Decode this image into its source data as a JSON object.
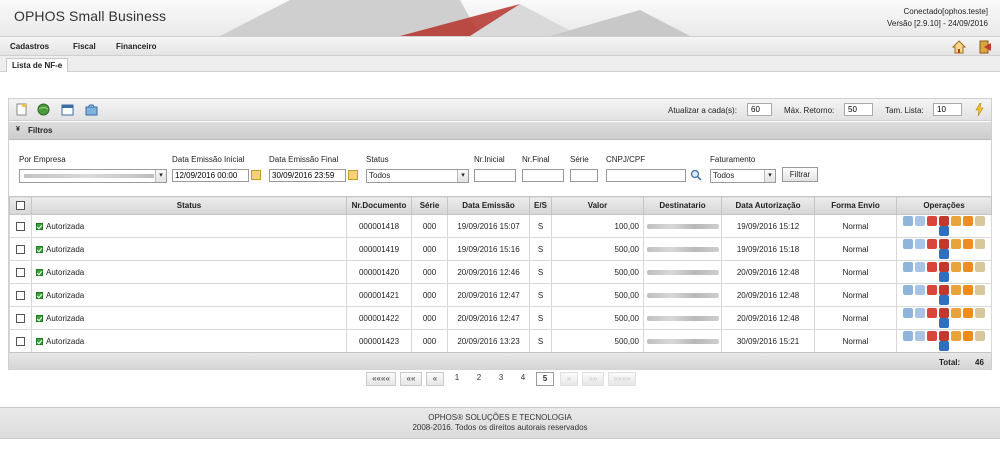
{
  "app": {
    "title": "OPHOS Small Business",
    "connected": "Conectado[ophos.teste]",
    "version": "Versão [2.9.10] - 24/09/2016"
  },
  "menu": {
    "items": [
      "Cadastros",
      "Fiscal",
      "Financeiro"
    ]
  },
  "header_icons": [
    "home-icon",
    "exit-icon"
  ],
  "tab": {
    "label": "Lista de NF-e"
  },
  "toolbar": {
    "icons": [
      "new-document-icon",
      "globe-icon",
      "calendar-icon",
      "refresh-folder-icon"
    ],
    "refresh_label": "Atualizar a cada(s):",
    "refresh_value": "60",
    "max_return_label": "Máx. Retorno:",
    "max_return_value": "50",
    "list_size_label": "Tam. Lista:",
    "list_size_value": "10",
    "flash_icon": "lightning-icon"
  },
  "filters": {
    "title": "Filtros",
    "empresa_label": "Por Empresa",
    "data_ini_label": "Data Emissão Inicial",
    "data_ini_value": "12/09/2016 00:00",
    "data_fim_label": "Data Emissão Final",
    "data_fim_value": "30/09/2016 23:59",
    "status_label": "Status",
    "status_value": "Todos",
    "nr_inicial_label": "Nr.Inicial",
    "nr_final_label": "Nr.Final",
    "serie_label": "Série",
    "cnpj_label": "CNPJ/CPF",
    "faturamento_label": "Faturamento",
    "faturamento_value": "Todos",
    "filter_button": "Filtrar"
  },
  "table": {
    "headers": [
      "Status",
      "Nr.Documento",
      "Série",
      "Data Emissão",
      "E/S",
      "Valor",
      "Destinatario",
      "Data Autorização",
      "Forma Envio",
      "Operações"
    ],
    "rows": [
      {
        "status": "Autorizada",
        "doc": "000001418",
        "serie": "000",
        "emissao": "19/09/2016 15:07",
        "es": "S",
        "valor": "100,00",
        "autorizacao": "19/09/2016 15:12",
        "envio": "Normal"
      },
      {
        "status": "Autorizada",
        "doc": "000001419",
        "serie": "000",
        "emissao": "19/09/2016 15:16",
        "es": "S",
        "valor": "500,00",
        "autorizacao": "19/09/2016 15:18",
        "envio": "Normal"
      },
      {
        "status": "Autorizada",
        "doc": "000001420",
        "serie": "000",
        "emissao": "20/09/2016 12:46",
        "es": "S",
        "valor": "500,00",
        "autorizacao": "20/09/2016 12:48",
        "envio": "Normal"
      },
      {
        "status": "Autorizada",
        "doc": "000001421",
        "serie": "000",
        "emissao": "20/09/2016 12:47",
        "es": "S",
        "valor": "500,00",
        "autorizacao": "20/09/2016 12:48",
        "envio": "Normal"
      },
      {
        "status": "Autorizada",
        "doc": "000001422",
        "serie": "000",
        "emissao": "20/09/2016 12:47",
        "es": "S",
        "valor": "500,00",
        "autorizacao": "20/09/2016 12:48",
        "envio": "Normal"
      },
      {
        "status": "Autorizada",
        "doc": "000001423",
        "serie": "000",
        "emissao": "20/09/2016 13:23",
        "es": "S",
        "valor": "500,00",
        "autorizacao": "30/09/2016 15:21",
        "envio": "Normal"
      }
    ],
    "operation_icons": [
      "magnify-icon",
      "copy-icon",
      "cancel-icon",
      "pdf-icon",
      "xml-icon",
      "rss-icon",
      "email-icon",
      "info-icon"
    ],
    "total_label": "Total:",
    "total_value": "46"
  },
  "pager": {
    "first": "««««",
    "prev_block": "««",
    "prev": "«",
    "pages": [
      "1",
      "2",
      "3",
      "4",
      "5"
    ],
    "current": "5",
    "next": "»",
    "next_block": "»»",
    "last": "»»»»"
  },
  "footer": {
    "line1": "OPHOS® SOLUÇÕES E TECNOLOGIA",
    "line2": "2008-2016. Todos os direitos autorais reservados"
  },
  "colors": {
    "accent": "#c0392b",
    "ok": "#3aa53a",
    "panel_header": "#d6d6d6"
  }
}
